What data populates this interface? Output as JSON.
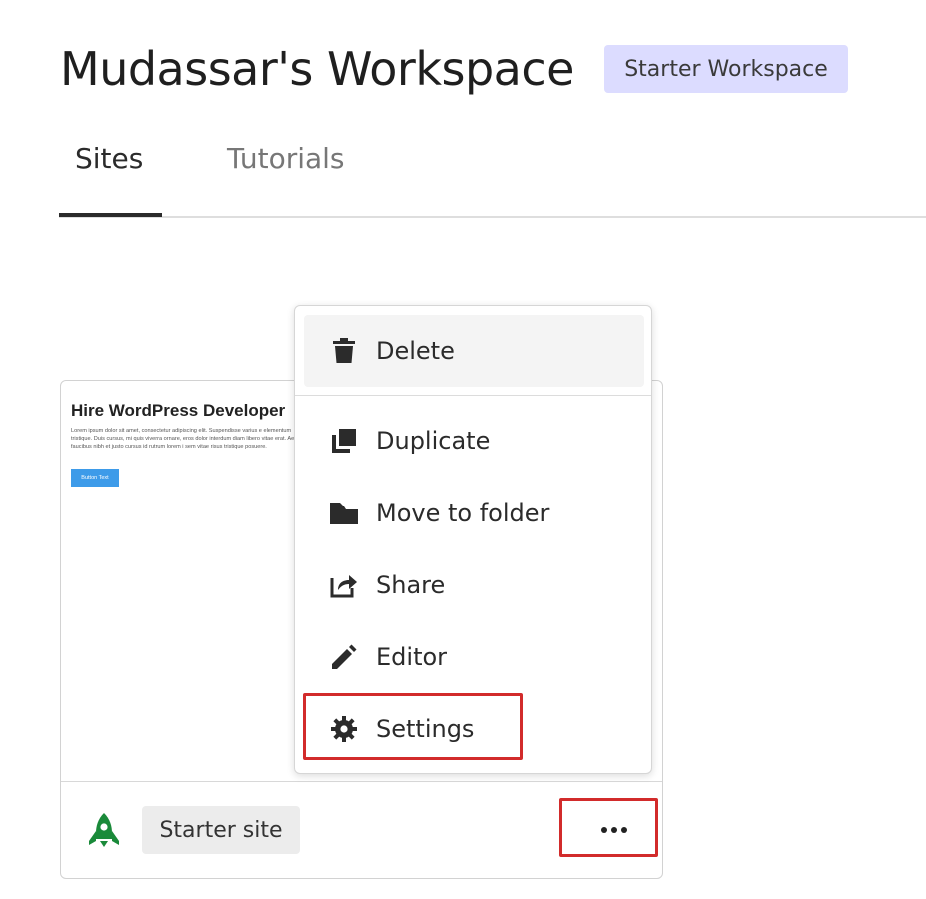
{
  "header": {
    "title": "Mudassar's Workspace",
    "plan_badge": "Starter Workspace"
  },
  "tabs": [
    {
      "label": "Sites",
      "active": true
    },
    {
      "label": "Tutorials",
      "active": false
    }
  ],
  "site_card": {
    "preview": {
      "heading": "Hire WordPress Developer",
      "body": "Lorem ipsum dolor sit amet, consectetur adipiscing elit. Suspendisse varius e elementum tristique. Duis cursus, mi quis viverra ornare, eros dolor interdum diam libero vitae erat. Aenean faucibus nibh et justo cursus id rutrum lorem i sem vitae risus tristique posuere.",
      "button": "Button Text"
    },
    "site_type_icon": "rocket-icon",
    "site_badge": "Starter site",
    "more_icon": "more-horizontal-icon"
  },
  "context_menu": {
    "items": [
      {
        "label": "Delete",
        "icon": "trash-icon"
      },
      {
        "label": "Duplicate",
        "icon": "copy-icon"
      },
      {
        "label": "Move to folder",
        "icon": "folder-icon"
      },
      {
        "label": "Share",
        "icon": "share-icon"
      },
      {
        "label": "Editor",
        "icon": "pencil-icon"
      },
      {
        "label": "Settings",
        "icon": "gear-icon"
      }
    ]
  },
  "colors": {
    "plan_badge_bg": "#dcdcff",
    "accent_green": "#1a8a3a",
    "highlight_red": "#d22b2b",
    "preview_button": "#3d9be9"
  }
}
